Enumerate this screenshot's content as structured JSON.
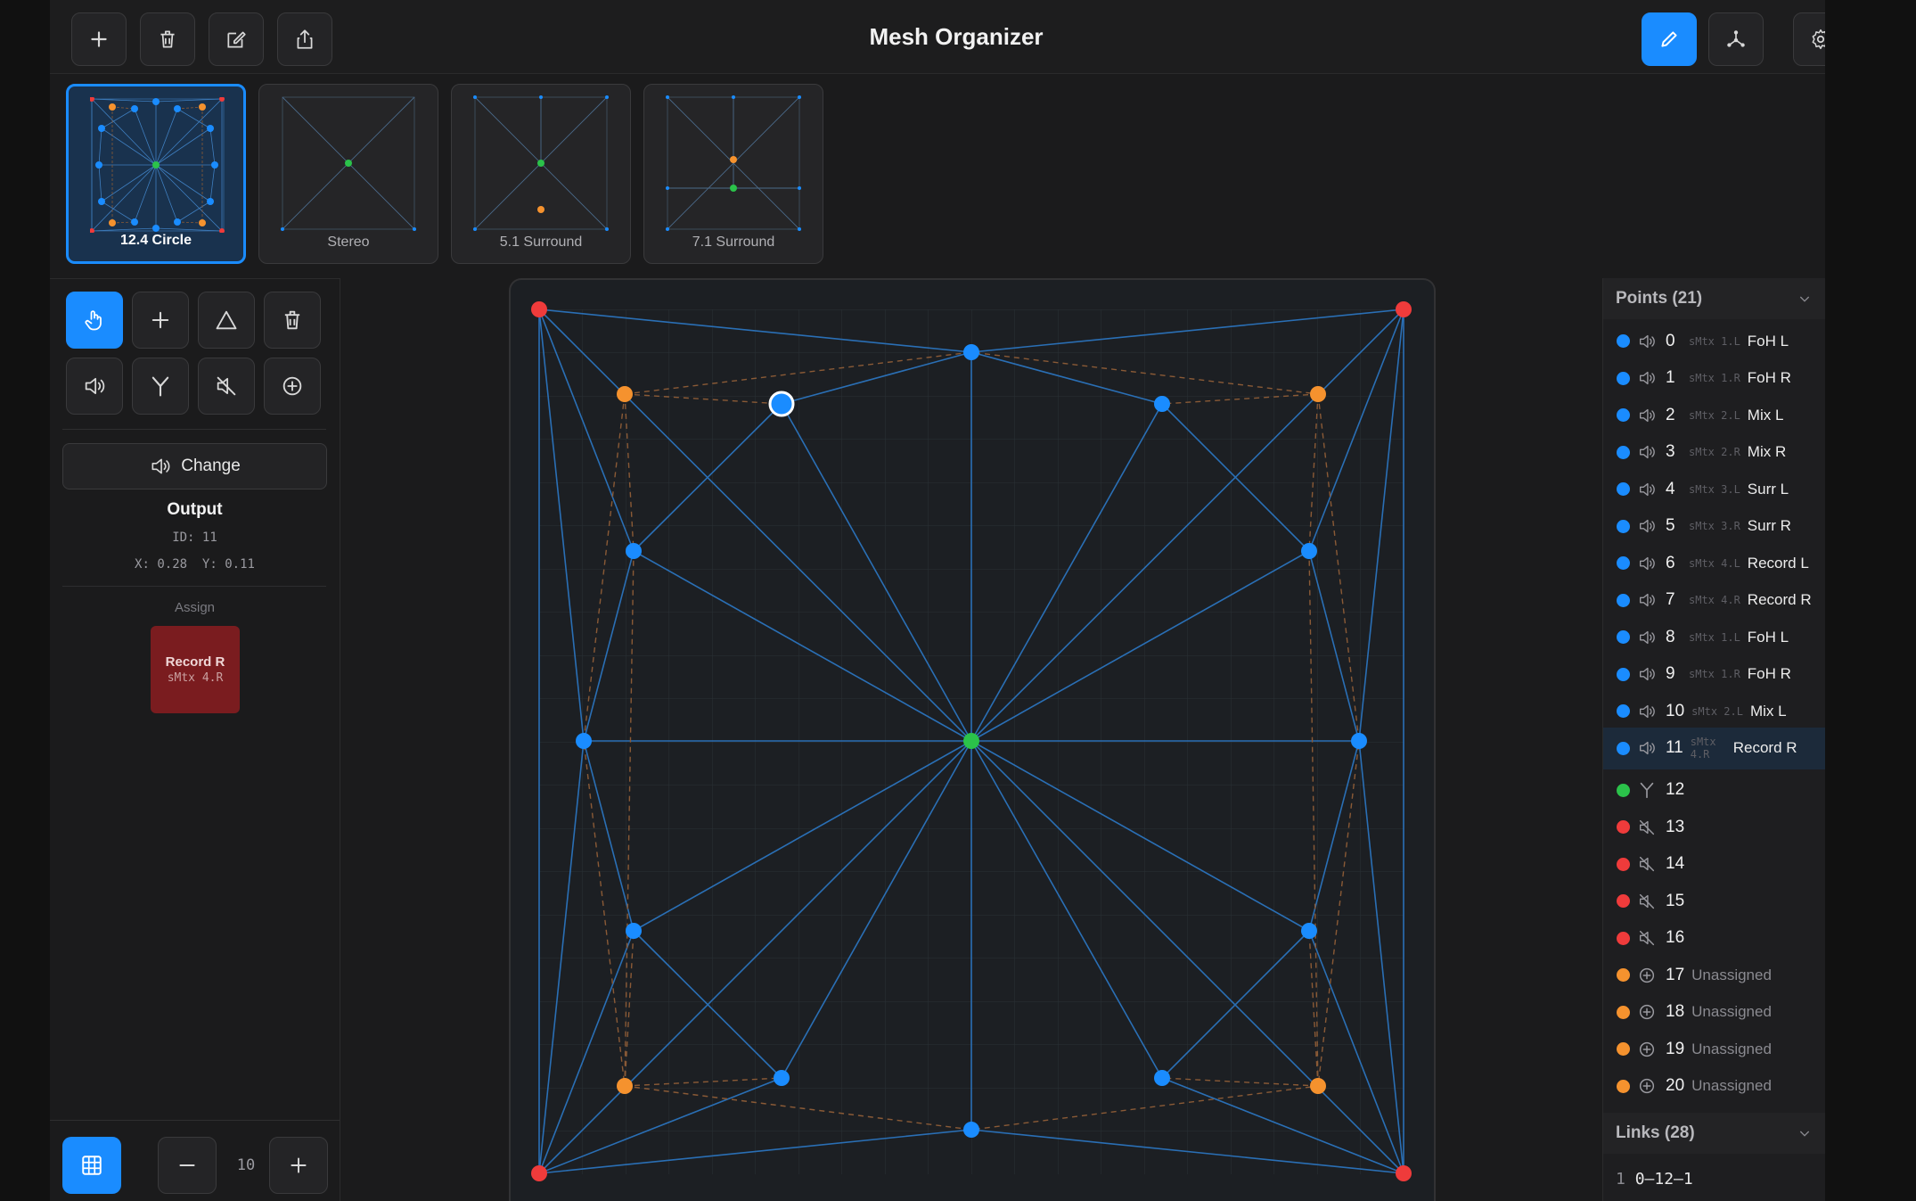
{
  "app": {
    "title": "Mesh Organizer"
  },
  "toolbar": {
    "left": [
      {
        "name": "add-button",
        "icon": "plus-icon"
      },
      {
        "name": "delete-button",
        "icon": "trash-icon"
      },
      {
        "name": "edit-button",
        "icon": "edit-icon"
      },
      {
        "name": "share-button",
        "icon": "share-icon"
      }
    ],
    "right": [
      {
        "name": "draw-mode-button",
        "icon": "pencil-icon",
        "active": true
      },
      {
        "name": "mesh-mode-button",
        "icon": "graph-icon",
        "active": false
      },
      {
        "name": "settings-button",
        "icon": "gear-icon",
        "active": false
      }
    ]
  },
  "presets": [
    {
      "label": "12.4 Circle",
      "active": true
    },
    {
      "label": "Stereo",
      "active": false
    },
    {
      "label": "5.1 Surround",
      "active": false
    },
    {
      "label": "7.1 Surround",
      "active": false
    }
  ],
  "tools": {
    "row1": [
      {
        "name": "select-tool",
        "icon": "hand-pointer-icon",
        "active": true
      },
      {
        "name": "add-point-tool",
        "icon": "plus-icon",
        "active": false
      },
      {
        "name": "triangle-tool",
        "icon": "triangle-icon",
        "active": false
      },
      {
        "name": "delete-tool",
        "icon": "trash-icon",
        "active": false
      }
    ],
    "row2": [
      {
        "name": "output-tool",
        "icon": "speaker-icon",
        "active": false
      },
      {
        "name": "split-tool",
        "icon": "fork-icon",
        "active": false
      },
      {
        "name": "mute-tool",
        "icon": "speaker-muted-icon",
        "active": false
      },
      {
        "name": "unassigned-tool",
        "icon": "plus-circle-icon",
        "active": false
      }
    ],
    "change_label": "Change"
  },
  "inspector": {
    "type": "Output",
    "id": "ID: 11",
    "x": "X: 0.28",
    "y": "Y: 0.11",
    "assign_label": "Assign",
    "assign_name": "Record R",
    "assign_sub": "sMtx 4.R"
  },
  "zoom": {
    "value": "10"
  },
  "colors": {
    "accent": "#1a8cff",
    "output": "#1a8cff",
    "split": "#2bc24a",
    "muted": "#ef3b3b",
    "unassigned": "#f5922e",
    "edge": "#2a6fb5",
    "edge_dashed": "#8a5a36"
  },
  "points_panel": {
    "title": "Points (21)",
    "rows": [
      {
        "id": "0",
        "type": "output",
        "sub": "sMtx 1.L",
        "name": "FoH L"
      },
      {
        "id": "1",
        "type": "output",
        "sub": "sMtx 1.R",
        "name": "FoH R"
      },
      {
        "id": "2",
        "type": "output",
        "sub": "sMtx 2.L",
        "name": "Mix L"
      },
      {
        "id": "3",
        "type": "output",
        "sub": "sMtx 2.R",
        "name": "Mix R"
      },
      {
        "id": "4",
        "type": "output",
        "sub": "sMtx 3.L",
        "name": "Surr L"
      },
      {
        "id": "5",
        "type": "output",
        "sub": "sMtx 3.R",
        "name": "Surr R"
      },
      {
        "id": "6",
        "type": "output",
        "sub": "sMtx 4.L",
        "name": "Record L"
      },
      {
        "id": "7",
        "type": "output",
        "sub": "sMtx 4.R",
        "name": "Record R"
      },
      {
        "id": "8",
        "type": "output",
        "sub": "sMtx 1.L",
        "name": "FoH L"
      },
      {
        "id": "9",
        "type": "output",
        "sub": "sMtx 1.R",
        "name": "FoH R"
      },
      {
        "id": "10",
        "type": "output",
        "sub": "sMtx 2.L",
        "name": "Mix L"
      },
      {
        "id": "11",
        "type": "output",
        "sub": "sMtx 4.R",
        "name": "Record R",
        "selected": true
      },
      {
        "id": "12",
        "type": "split",
        "sub": "",
        "name": ""
      },
      {
        "id": "13",
        "type": "muted",
        "sub": "",
        "name": ""
      },
      {
        "id": "14",
        "type": "muted",
        "sub": "",
        "name": ""
      },
      {
        "id": "15",
        "type": "muted",
        "sub": "",
        "name": ""
      },
      {
        "id": "16",
        "type": "muted",
        "sub": "",
        "name": ""
      },
      {
        "id": "17",
        "type": "unassigned",
        "sub": "",
        "name": "Unassigned"
      },
      {
        "id": "18",
        "type": "unassigned",
        "sub": "",
        "name": "Unassigned"
      },
      {
        "id": "19",
        "type": "unassigned",
        "sub": "",
        "name": "Unassigned"
      },
      {
        "id": "20",
        "type": "unassigned",
        "sub": "",
        "name": "Unassigned"
      }
    ]
  },
  "links_panel": {
    "title": "Links (28)",
    "first_link": {
      "index": "1",
      "value": "0–12–1"
    }
  }
}
